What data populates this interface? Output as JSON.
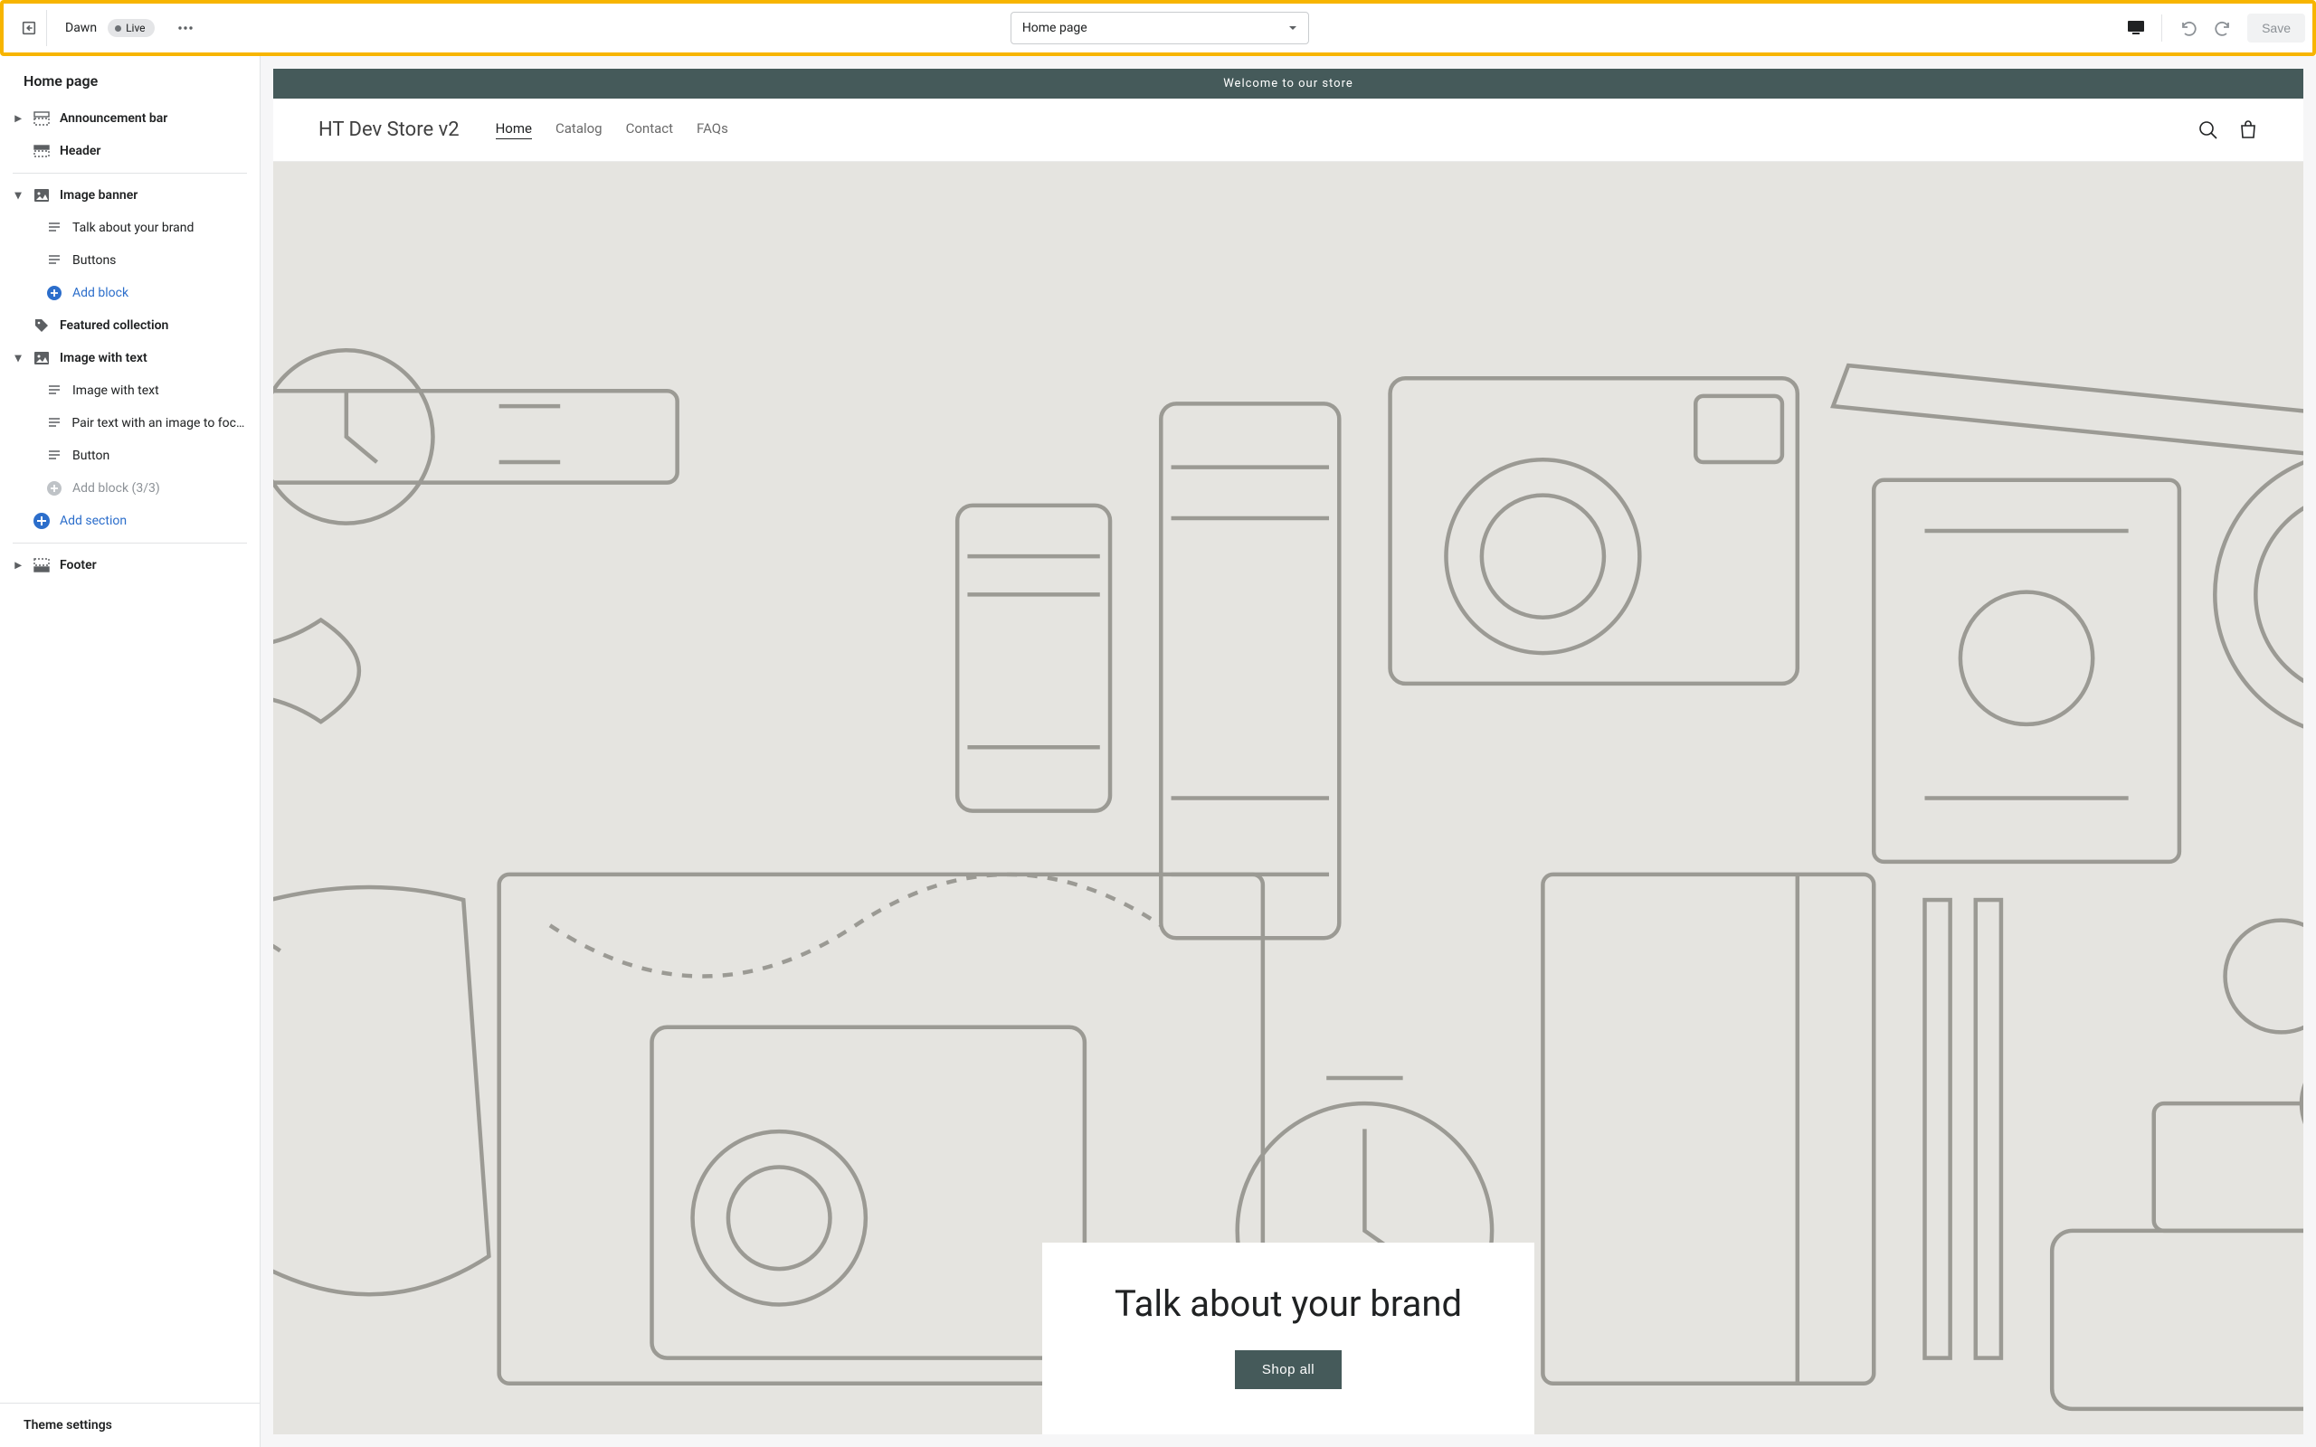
{
  "toolbar": {
    "theme_name": "Dawn",
    "status_label": "Live",
    "page_select": "Home page",
    "save_label": "Save"
  },
  "sidebar": {
    "title": "Home page",
    "announcement_bar": "Announcement bar",
    "header": "Header",
    "image_banner": "Image banner",
    "image_banner_children": {
      "talk": "Talk about your brand",
      "buttons": "Buttons",
      "add_block": "Add block"
    },
    "featured_collection": "Featured collection",
    "image_with_text": "Image with text",
    "image_with_text_children": {
      "iwt": "Image with text",
      "pair": "Pair text with an image to focu...",
      "button": "Button",
      "add_block": "Add block (3/3)"
    },
    "add_section": "Add section",
    "footer": "Footer",
    "theme_settings": "Theme settings"
  },
  "preview": {
    "announcement": "Welcome to our store",
    "store_name": "HT Dev Store v2",
    "nav": {
      "home": "Home",
      "catalog": "Catalog",
      "contact": "Contact",
      "faqs": "FAQs"
    },
    "hero_title": "Talk about your brand",
    "hero_button": "Shop all"
  }
}
